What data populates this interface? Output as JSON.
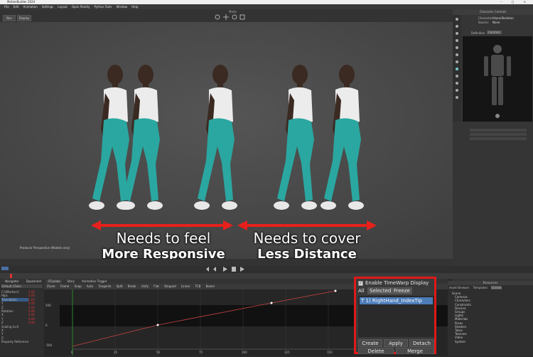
{
  "window": {
    "title": "MotionBuilder 2024",
    "controls": "– □ ×"
  },
  "menu": [
    "File",
    "Edit",
    "Animation",
    "Settings",
    "Layout",
    "Open Reality",
    "Python Tools",
    "Window",
    "Help"
  ],
  "toolbar": {
    "left_btn1": "Nav",
    "left_btn2": "Display",
    "center_label": "Mode"
  },
  "viewport": {
    "caption1_line1": "Needs to feel",
    "caption1_line2": "More Responsive",
    "caption2_line1": "Needs to cover",
    "caption2_line2": "Less Distance",
    "status": "Producer Perspective (Models only)",
    "arrow_color": "#e8201c",
    "figure_shirt": "#ececec",
    "figure_pants": "#2aa7a0",
    "figure_skin": "#3b2a22"
  },
  "right_panel": {
    "header": "Character Controls",
    "tab1": "Definition",
    "tab2": "Controls",
    "character_label": "Character:",
    "character_value": "IdaaroSkeleton",
    "source_label": "Source:",
    "source_value": "None"
  },
  "tabs": [
    "Navigator",
    "Dopesheet",
    "FCurves",
    "Story",
    "Animation Trigger"
  ],
  "nav_panel": {
    "header": "Default (Take)",
    "items": [
      "C:\\[Markers]",
      "Hips",
      "Translation",
      "Y",
      "Z",
      "Rotation",
      "X",
      "Y",
      "Z",
      "Scaling (Lcl)",
      "X",
      "Y",
      "Z",
      "Property Reference"
    ],
    "values": [
      "0.00",
      "0.00",
      "0.00",
      "0.00",
      "0.00",
      "0.00",
      "0.00",
      "0.00",
      "0.00"
    ]
  },
  "graph": {
    "toolbar": [
      "Zoom",
      "Frame",
      "Snap",
      "Auto",
      "Tangents",
      "Split",
      "Break",
      "Unify",
      "Flat",
      "Stepped",
      "Linear",
      "TCB",
      "Bezier"
    ],
    "y_labels": [
      "500",
      "0",
      "-500"
    ],
    "x_labels": [
      "0",
      "25",
      "50",
      "75",
      "100",
      "125",
      "150",
      "175",
      "200",
      "225",
      "250"
    ]
  },
  "timewarp": {
    "enable_label": "Enable TimeWarp Display",
    "tab_all": "All",
    "tab_selected": "Selected",
    "tab_freeze": "Freeze",
    "item": "T 1) RightHand_IndexTip",
    "btn_create": "Create",
    "btn_apply": "Apply",
    "btn_detach": "Detach",
    "btn_delete": "Delete",
    "btn_merge": "Merge"
  },
  "scene_nav": {
    "header": "Resources",
    "tabs": [
      "Asset Browser",
      "Templates",
      "Scenes"
    ],
    "tree": [
      "Scene",
      "Cameras",
      "Characters",
      "Constraints",
      "Devices",
      "Groups",
      "Lights",
      "Materials",
      "Poses",
      "Shaders",
      "Takes",
      "Textures",
      "Video",
      "System"
    ]
  }
}
